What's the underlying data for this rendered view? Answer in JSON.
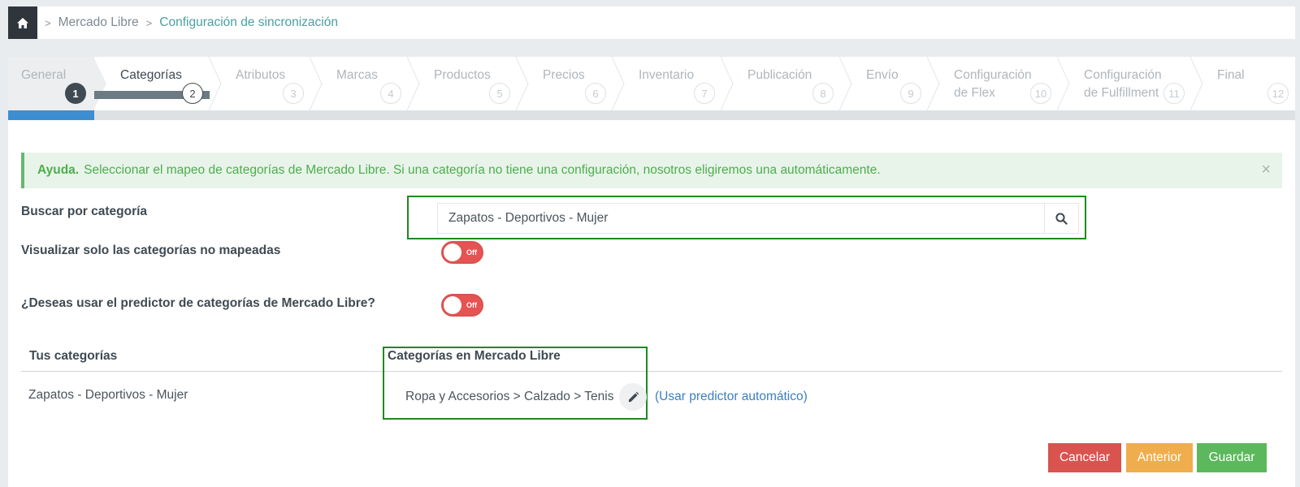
{
  "breadcrumb": {
    "items": [
      "Mercado Libre",
      "Configuración de sincronización"
    ]
  },
  "wizard": {
    "steps": [
      {
        "label": "General",
        "num": "1"
      },
      {
        "label": "Categorías",
        "num": "2"
      },
      {
        "label": "Atributos",
        "num": "3"
      },
      {
        "label": "Marcas",
        "num": "4"
      },
      {
        "label": "Productos",
        "num": "5"
      },
      {
        "label": "Precios",
        "num": "6"
      },
      {
        "label": "Inventario",
        "num": "7"
      },
      {
        "label": "Publicación",
        "num": "8"
      },
      {
        "label": "Envío",
        "num": "9"
      },
      {
        "label": "Configuración\nde Flex",
        "num": "10"
      },
      {
        "label": "Configuración\nde Fulfillment",
        "num": "11"
      },
      {
        "label": "Final",
        "num": "12"
      }
    ]
  },
  "alert": {
    "title": "Ayuda.",
    "message": "Seleccionar el mapeo de categorías de Mercado Libre. Si una categoría no tiene una configuración, nosotros eligiremos una automáticamente.",
    "close": "×"
  },
  "form": {
    "search_label": "Buscar por categoría",
    "search_value": "Zapatos - Deportivos - Mujer",
    "unmapped_label": "Visualizar solo las categorías no mapeadas",
    "unmapped_toggle": "Off",
    "predictor_label": "¿Deseas usar el predictor de categorías de Mercado Libre?",
    "predictor_toggle": "Off"
  },
  "table": {
    "headers": [
      "Tus categorías",
      "Categorías en Mercado Libre"
    ],
    "row": {
      "category": "Zapatos - Deportivos - Mujer",
      "ml_category": "Ropa y Accesorios > Calzado > Tenis",
      "predict_link": "(Usar predictor automático)"
    }
  },
  "actions": {
    "cancel": "Cancelar",
    "previous": "Anterior",
    "save": "Guardar"
  },
  "colors": {
    "accent": "#3d8ed0",
    "success": "#5cb85c",
    "danger": "#d9534f",
    "warning": "#f0ad4e"
  }
}
